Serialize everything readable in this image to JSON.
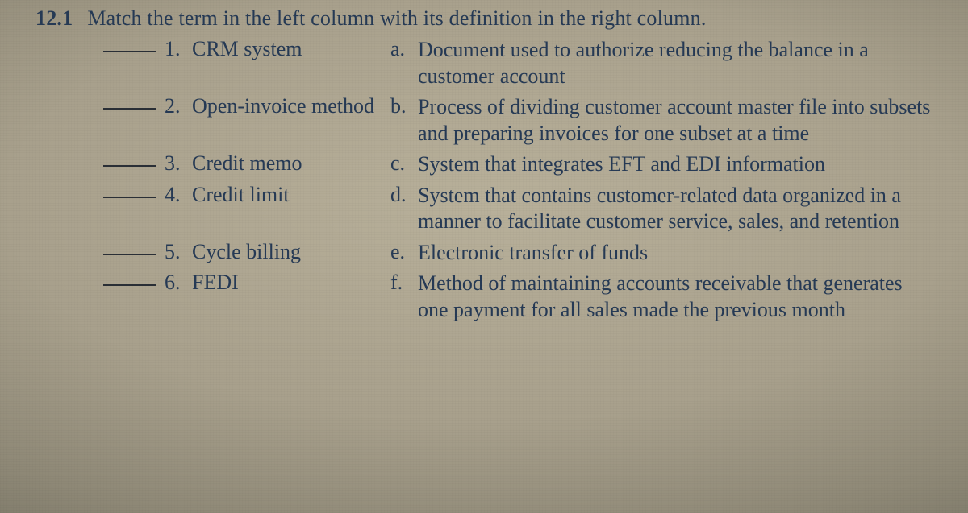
{
  "question_number": "12.1",
  "instruction": "Match the term in the left column with its definition in the right column.",
  "terms": [
    {
      "num": "1.",
      "text": "CRM system"
    },
    {
      "num": "2.",
      "text": "Open-invoice method"
    },
    {
      "num": "3.",
      "text": "Credit memo"
    },
    {
      "num": "4.",
      "text": "Credit limit"
    },
    {
      "num": "5.",
      "text": "Cycle billing"
    },
    {
      "num": "6.",
      "text": "FEDI"
    }
  ],
  "definitions": [
    {
      "letter": "a.",
      "text": "Document used to authorize reducing the balance in a customer account"
    },
    {
      "letter": "b.",
      "text": "Process of dividing customer account master file into subsets and preparing invoices for one subset at a time"
    },
    {
      "letter": "c.",
      "text": "System that integrates EFT and EDI information"
    },
    {
      "letter": "d.",
      "text": "System that contains customer-related data organized in a manner to facilitate customer service, sales, and retention"
    },
    {
      "letter": "e.",
      "text": "Electronic transfer of funds"
    },
    {
      "letter": "f.",
      "text": "Method of maintaining accounts receivable that generates one payment for all sales made the previous month"
    }
  ]
}
